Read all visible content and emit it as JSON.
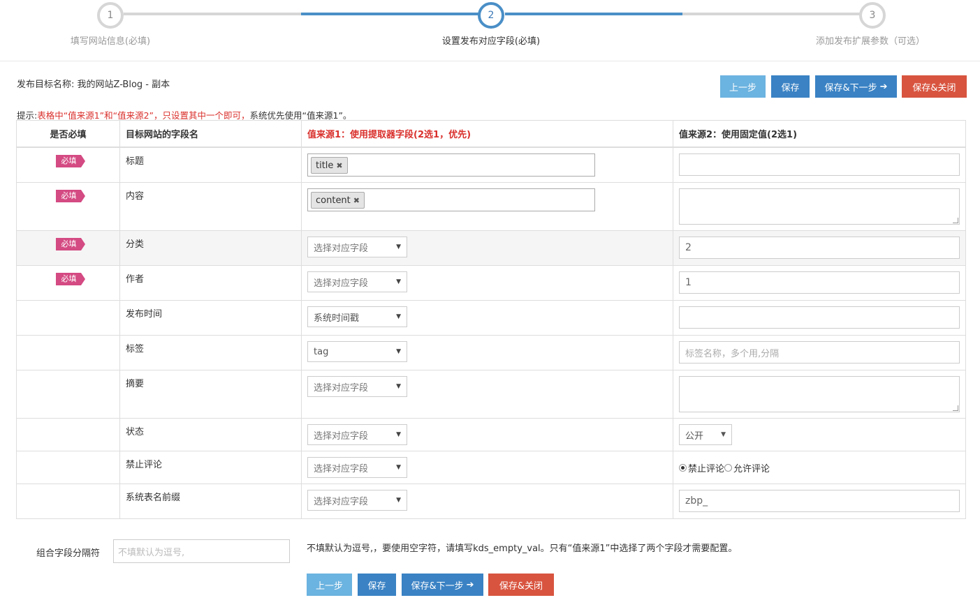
{
  "stepper": {
    "steps": [
      {
        "number": "1",
        "label": "填写网站信息(必填)"
      },
      {
        "number": "2",
        "label": "设置发布对应字段(必填)"
      },
      {
        "number": "3",
        "label": "添加发布扩展参数（可选）"
      }
    ],
    "active_step": 2
  },
  "target": {
    "label": "发布目标名称:",
    "name": "我的网站Z-Blog - 副本"
  },
  "toolbar": {
    "prev_label": "上一步",
    "save_label": "保存",
    "save_next_label": "保存&下一步",
    "save_close_label": "保存&关闭"
  },
  "hint": {
    "prefix": "提示:",
    "red": "表格中“值来源1”和“值来源2”，只设置其中一个即可，",
    "suffix": "系统优先使用“值来源1”。"
  },
  "table": {
    "headers": [
      "是否必填",
      "目标网站的字段名",
      "值来源1：使用提取器字段(2选1，优先)",
      "值来源2：使用固定值(2选1)"
    ],
    "required_badge": "必填",
    "rows": [
      {
        "name": "标题",
        "chip": "title",
        "fixed": ""
      },
      {
        "name": "内容",
        "chip": "content",
        "fixed": ""
      },
      {
        "name": "分类",
        "select": "选择对应字段",
        "fixed": "2"
      },
      {
        "name": "作者",
        "select": "选择对应字段",
        "fixed": "1"
      },
      {
        "name": "发布时间",
        "select": "系统时间戳",
        "fixed": ""
      },
      {
        "name": "标签",
        "select": "tag",
        "fixed_placeholder": "标签名称，多个用,分隔"
      },
      {
        "name": "摘要",
        "select": "选择对应字段"
      },
      {
        "name": "状态",
        "select": "选择对应字段",
        "status": "公开"
      },
      {
        "name": "禁止评论",
        "select": "选择对应字段",
        "radio_on": "禁止评论",
        "radio_off": "允许评论"
      },
      {
        "name": "系统表名前缀",
        "select": "选择对应字段",
        "fixed": "zbp_"
      }
    ]
  },
  "separator": {
    "label": "组合字段分隔符",
    "placeholder": "不填默认为逗号,",
    "note": "不填默认为逗号,，要使用空字符，请填写kds_empty_val。只有“值来源1”中选择了两个字段才需要配置。"
  },
  "colors": {
    "primary": "#3a82c4",
    "light": "#6bb3e0",
    "danger": "#d8543f",
    "badge": "#d44a82",
    "hint_red": "#d9302c"
  }
}
